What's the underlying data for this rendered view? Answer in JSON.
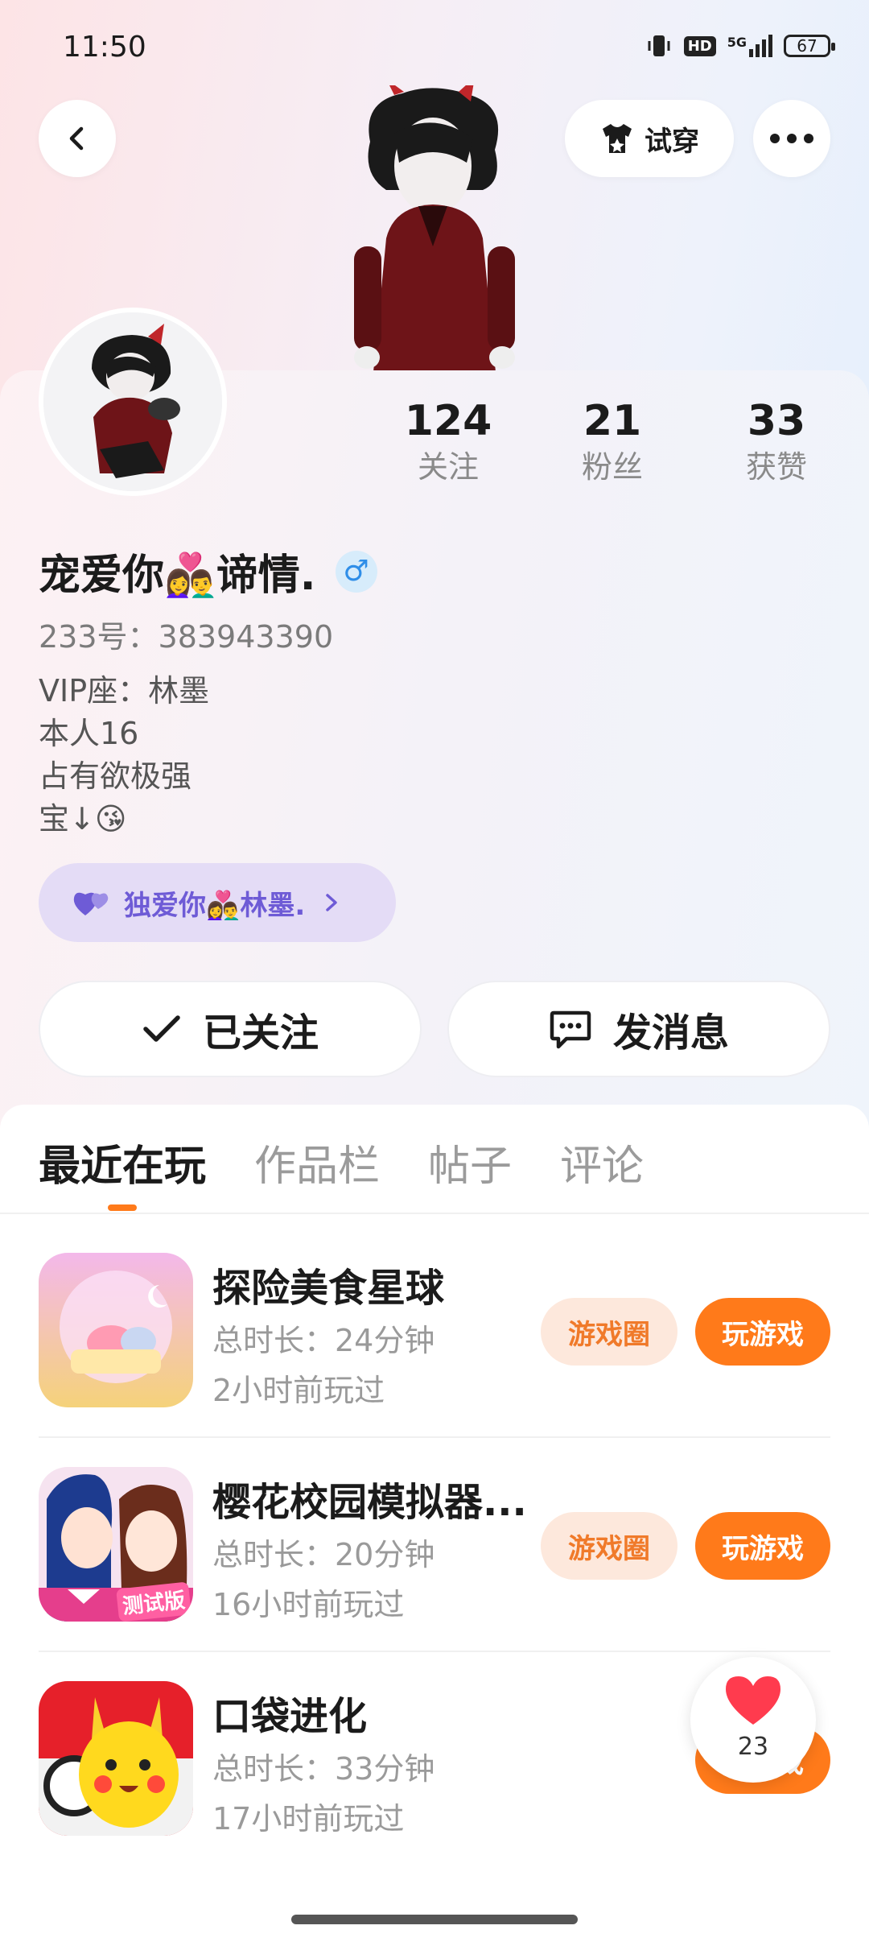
{
  "status_bar": {
    "time": "11:50",
    "network": "5G",
    "hd": "HD",
    "battery": "67"
  },
  "header": {
    "tryon_label": "试穿"
  },
  "profile": {
    "stats": [
      {
        "value": "124",
        "label": "关注"
      },
      {
        "value": "21",
        "label": "粉丝"
      },
      {
        "value": "33",
        "label": "获赞"
      }
    ],
    "nickname": "宠爱你👩‍❤️‍👨谛情.",
    "gender_symbol": "♂",
    "uid_line": "233号：383943390",
    "bio": [
      "VIP座：林墨",
      "本人16",
      "占有欲极强",
      "宝↓😘"
    ],
    "cp_label": "独爱你👩‍❤️‍👨林墨.",
    "follow_label": "已关注",
    "message_label": "发消息"
  },
  "tabs": [
    {
      "label": "最近在玩",
      "active": true
    },
    {
      "label": "作品栏",
      "active": false
    },
    {
      "label": "帖子",
      "active": false
    },
    {
      "label": "评论",
      "active": false
    }
  ],
  "games": [
    {
      "name": "探险美食星球",
      "duration": "总时长：24分钟",
      "last_played": "2小时前玩过",
      "circle_label": "游戏圈",
      "play_label": "玩游戏"
    },
    {
      "name": "樱花校园模拟器...",
      "duration": "总时长：20分钟",
      "last_played": "16小时前玩过",
      "circle_label": "游戏圈",
      "play_label": "玩游戏",
      "icon_badge": "测试版"
    },
    {
      "name": "口袋进化",
      "duration": "总时长：33分钟",
      "last_played": "17小时前玩过",
      "play_label": "玩游戏"
    }
  ],
  "like_float": {
    "count": "23"
  },
  "colors": {
    "accent": "#ff7a1a",
    "accent_soft": "#fde8dc",
    "cp_bg": "#e4dcf6",
    "cp_text": "#6e5bd6",
    "heart": "#ff3b4e"
  }
}
